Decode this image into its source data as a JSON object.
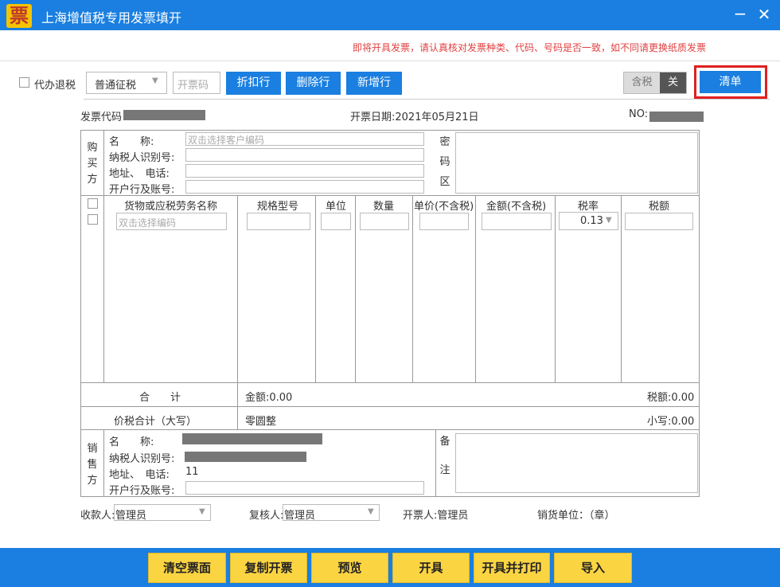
{
  "window": {
    "title": "上海增值税专用发票填开",
    "icon_char": "票",
    "minimize": "−",
    "close": "✕"
  },
  "notice": "即将开具发票，请认真核对发票种类、代码、号码是否一致，如不同请更换纸质发票",
  "toolbar": {
    "refund_label": "代办退税",
    "tax_type": "普通征税",
    "invoice_code_placeholder": "开票码",
    "discount_label": "折扣行",
    "delete_label": "删除行",
    "add_label": "新增行",
    "tax_incl_label": "含税",
    "toggle_label": "关",
    "list_label": "清单"
  },
  "header": {
    "code_label": "发票代码",
    "date_label": "开票日期:2021年05月21日",
    "no_label": "NO:"
  },
  "buyer": {
    "section_label": "购\n买\n方",
    "name_label": "名　　称:",
    "name_placeholder": "双击选择客户编码",
    "taxid_label": "纳税人识别号:",
    "addr_label": "地址、　电话:",
    "bank_label": "开户行及账号:",
    "password_label": "密\n码\n区"
  },
  "items": {
    "columns": [
      "货物或应税劳务名称",
      "规格型号",
      "单位",
      "数量",
      "单价(不含税)",
      "金额(不含税)",
      "税率",
      "税额"
    ],
    "name_placeholder": "双击选择编码",
    "tax_rate": "0.13"
  },
  "totals": {
    "sum_label": "合　　计",
    "amount": "金额:0.00",
    "tax": "税额:0.00",
    "capital_label": "价税合计（大写）",
    "capital_value": "零圆整",
    "small_value": "小写:0.00"
  },
  "seller": {
    "section_label": "销\n售\n方",
    "name_label": "名　　称:",
    "taxid_label": "纳税人识别号:",
    "addr_label": "地址、　电话:",
    "phone_value": "11",
    "bank_label": "开户行及账号:",
    "remarks_label": "备\n\n注"
  },
  "signers": {
    "payee_label": "收款人:",
    "payee_value": "管理员",
    "reviewer_label": "复核人:",
    "reviewer_value": "管理员",
    "drawer": "开票人:管理员",
    "seller_unit": "销货单位：（章）"
  },
  "bottom_buttons": [
    "清空票面",
    "复制开票",
    "预览",
    "开具",
    "开具并打印",
    "导入"
  ],
  "colors": {
    "title_bar": "#1a7fe0",
    "accent": "#1a7fe0",
    "notice": "#e04040",
    "bottom_bar": "#1a7fe0",
    "bottom_button": "#fbd442",
    "highlight": "#e02020"
  }
}
